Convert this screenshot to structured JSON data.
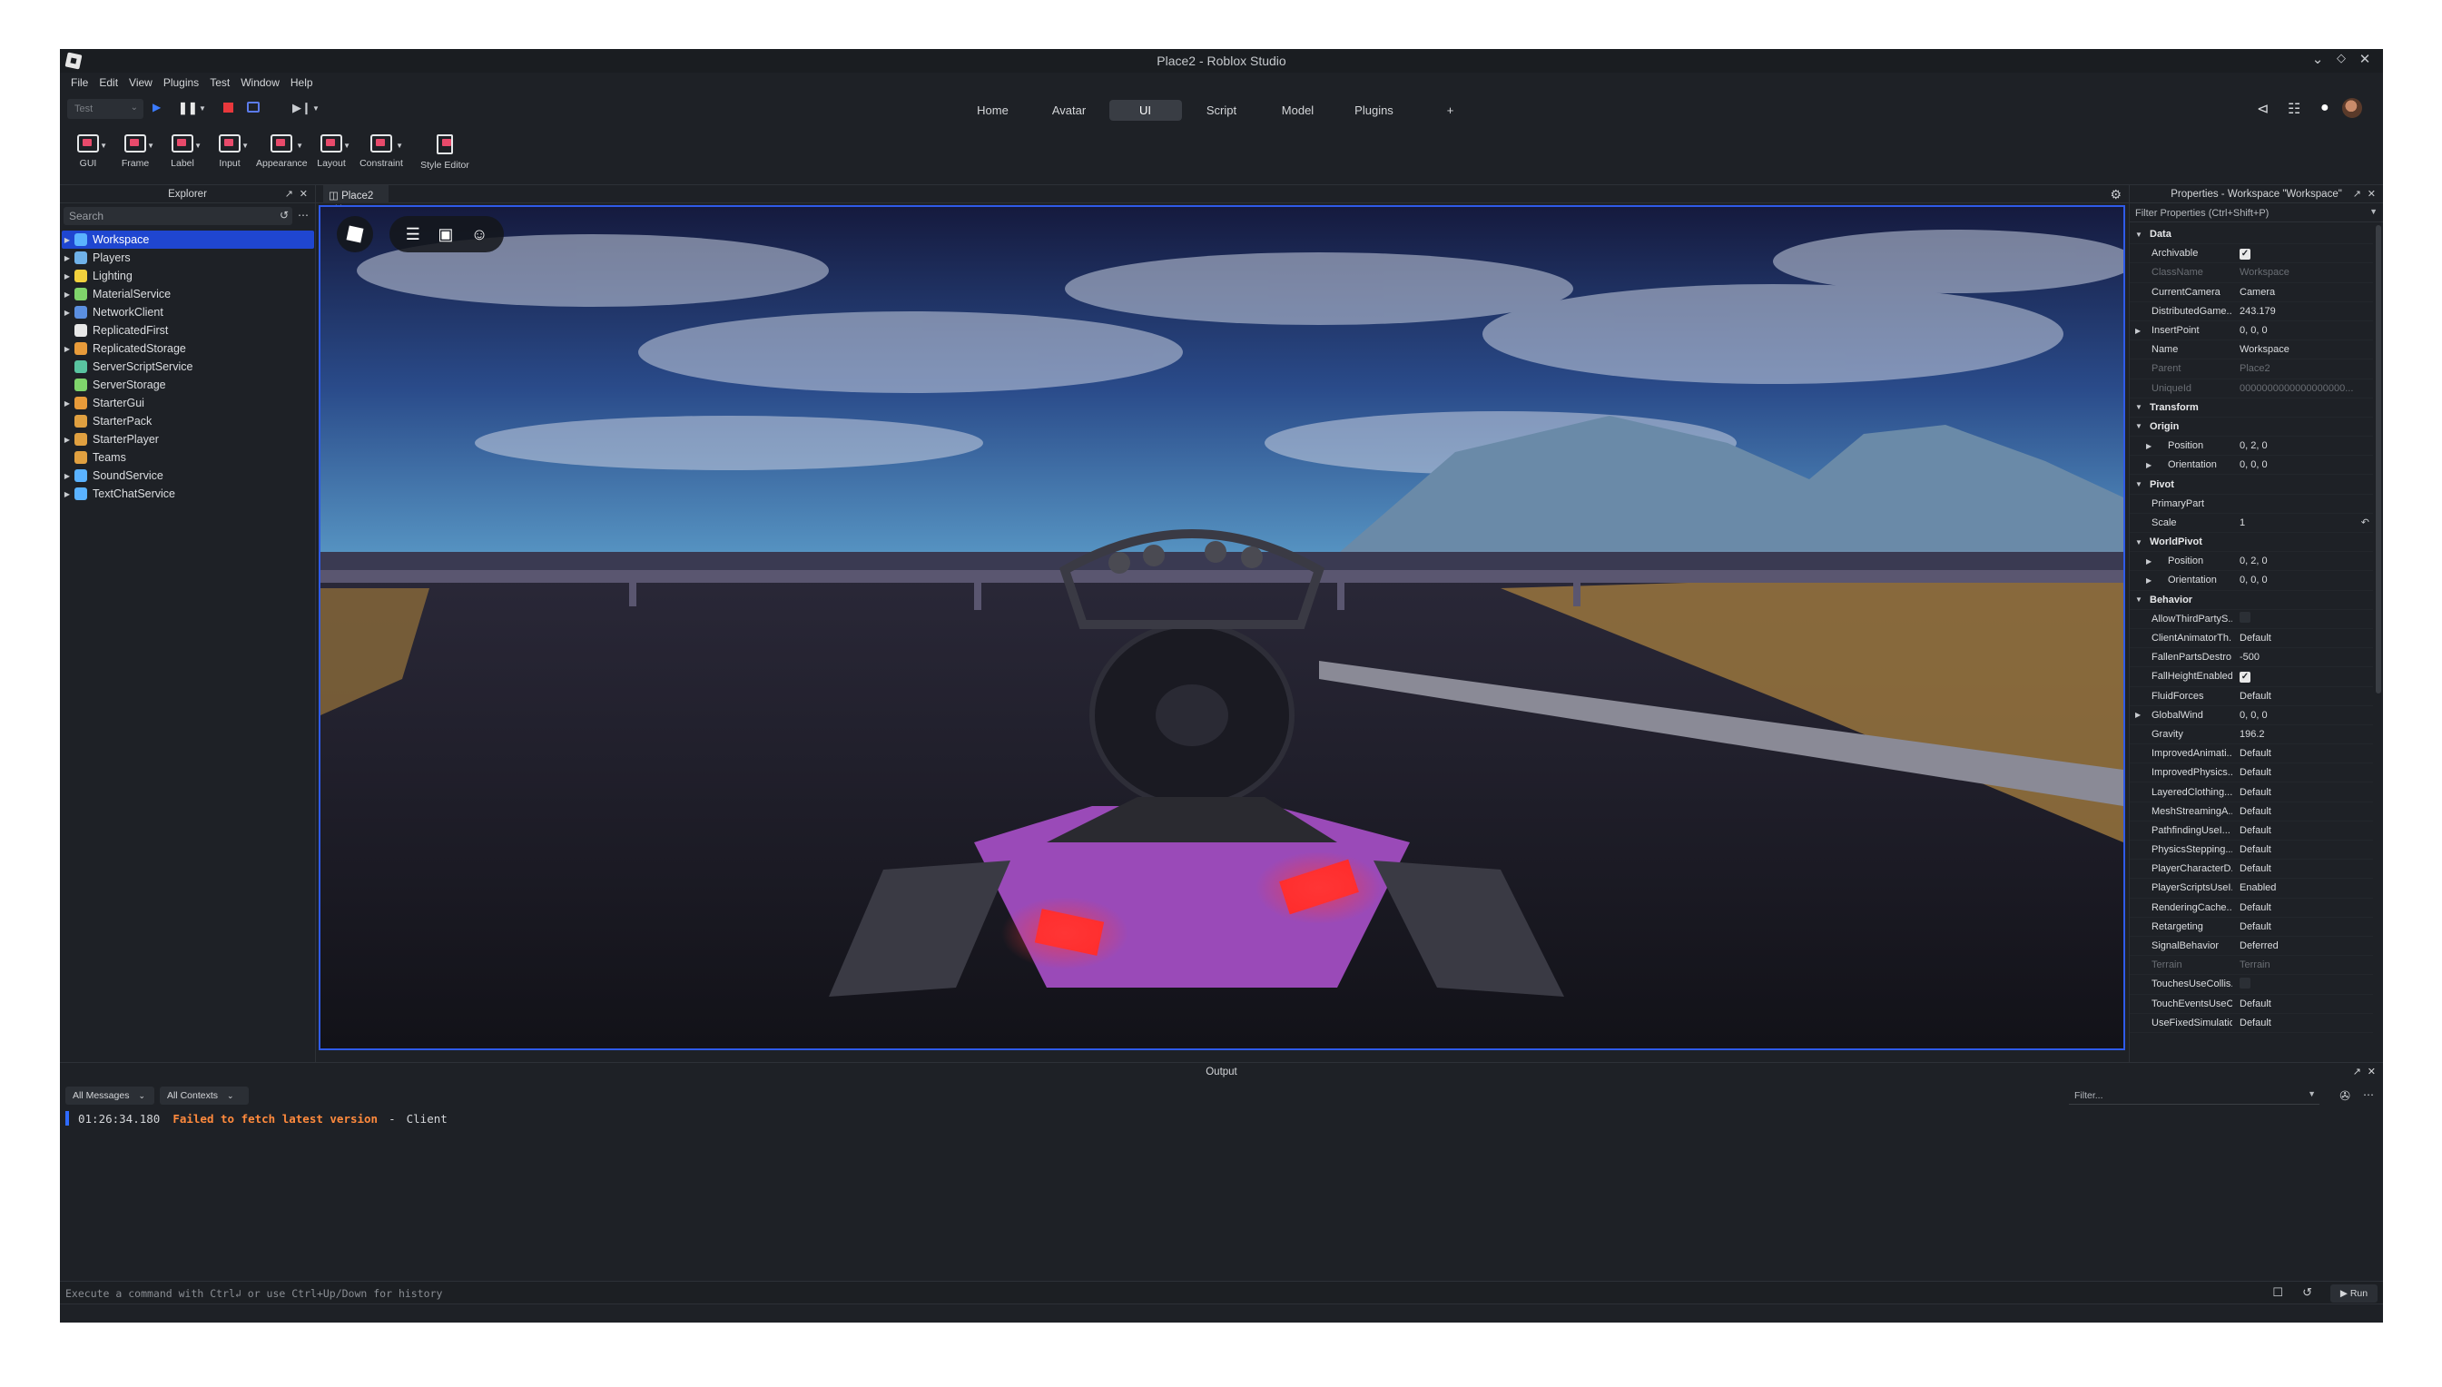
{
  "window": {
    "title": "Place2 - Roblox Studio"
  },
  "menu": [
    "File",
    "Edit",
    "View",
    "Plugins",
    "Test",
    "Window",
    "Help"
  ],
  "toolbar": {
    "test_select": "Test",
    "mode_tabs": [
      {
        "label": "Home",
        "active": false
      },
      {
        "label": "Avatar",
        "active": false
      },
      {
        "label": "UI",
        "active": true
      },
      {
        "label": "Script",
        "active": false
      },
      {
        "label": "Model",
        "active": false
      },
      {
        "label": "Plugins",
        "active": false
      }
    ],
    "add_tab": "+"
  },
  "ribbon": [
    {
      "label": "GUI",
      "name": "gui",
      "dropdown": true
    },
    {
      "label": "Frame",
      "name": "frame",
      "dropdown": true
    },
    {
      "label": "Label",
      "name": "label",
      "dropdown": true
    },
    {
      "label": "Input",
      "name": "input",
      "dropdown": true
    },
    {
      "label": "Appearance",
      "name": "appearance",
      "dropdown": true
    },
    {
      "label": "Layout",
      "name": "layout",
      "dropdown": true
    },
    {
      "label": "Constraint",
      "name": "constraint",
      "dropdown": true
    },
    {
      "label": "Style Editor",
      "name": "style-editor",
      "dropdown": false
    }
  ],
  "explorer": {
    "title": "Explorer",
    "search_placeholder": "Search",
    "items": [
      {
        "label": "Workspace",
        "selected": true,
        "color": "#5ab2ff",
        "expandable": true
      },
      {
        "label": "Players",
        "selected": false,
        "color": "#6fb1e8",
        "expandable": true
      },
      {
        "label": "Lighting",
        "selected": false,
        "color": "#f2d13d",
        "expandable": true
      },
      {
        "label": "MaterialService",
        "selected": false,
        "color": "#7fd46b",
        "expandable": true
      },
      {
        "label": "NetworkClient",
        "selected": false,
        "color": "#5b8fe0",
        "expandable": true
      },
      {
        "label": "ReplicatedFirst",
        "selected": false,
        "color": "#e8e8e8",
        "expandable": false
      },
      {
        "label": "ReplicatedStorage",
        "selected": false,
        "color": "#e89b3a",
        "expandable": true
      },
      {
        "label": "ServerScriptService",
        "selected": false,
        "color": "#59c4a0",
        "expandable": false
      },
      {
        "label": "ServerStorage",
        "selected": false,
        "color": "#7fd46b",
        "expandable": false
      },
      {
        "label": "StarterGui",
        "selected": false,
        "color": "#e89b3a",
        "expandable": true
      },
      {
        "label": "StarterPack",
        "selected": false,
        "color": "#e0a040",
        "expandable": false
      },
      {
        "label": "StarterPlayer",
        "selected": false,
        "color": "#e0a040",
        "expandable": true
      },
      {
        "label": "Teams",
        "selected": false,
        "color": "#e0a040",
        "expandable": false
      },
      {
        "label": "SoundService",
        "selected": false,
        "color": "#5ab2ff",
        "expandable": true
      },
      {
        "label": "TextChatService",
        "selected": false,
        "color": "#5ab2ff",
        "expandable": true
      }
    ]
  },
  "viewport": {
    "tab_label": "Place2"
  },
  "properties": {
    "title": "Properties - Workspace \"Workspace\"",
    "filter_placeholder": "Filter Properties (Ctrl+Shift+P)",
    "rows": [
      {
        "type": "cat",
        "name": "Data"
      },
      {
        "name": "Archivable",
        "value": "",
        "checkbox": true,
        "checked": true
      },
      {
        "name": "ClassName",
        "value": "Workspace",
        "dim": true
      },
      {
        "name": "CurrentCamera",
        "value": "Camera"
      },
      {
        "name": "DistributedGame...",
        "value": "243.179"
      },
      {
        "name": "InsertPoint",
        "value": "0, 0, 0",
        "expandable": true
      },
      {
        "name": "Name",
        "value": "Workspace"
      },
      {
        "name": "Parent",
        "value": "Place2",
        "dim": true
      },
      {
        "name": "UniqueId",
        "value": "0000000000000000000...",
        "dim": true
      },
      {
        "type": "cat",
        "name": "Transform"
      },
      {
        "type": "subcat",
        "name": "Origin"
      },
      {
        "name": "Position",
        "value": "0, 2, 0",
        "sub": true
      },
      {
        "name": "Orientation",
        "value": "0, 0, 0",
        "sub": true
      },
      {
        "type": "subcat",
        "name": "Pivot"
      },
      {
        "name": "PrimaryPart",
        "value": ""
      },
      {
        "name": "Scale",
        "value": "1",
        "reset": true
      },
      {
        "type": "subcat",
        "name": "WorldPivot"
      },
      {
        "name": "Position",
        "value": "0, 2, 0",
        "sub": true
      },
      {
        "name": "Orientation",
        "value": "0, 0, 0",
        "sub": true
      },
      {
        "type": "cat",
        "name": "Behavior"
      },
      {
        "name": "AllowThirdPartyS...",
        "value": "",
        "checkbox": true,
        "checked": false
      },
      {
        "name": "ClientAnimatorTh...",
        "value": "Default"
      },
      {
        "name": "FallenPartsDestro...",
        "value": "-500"
      },
      {
        "name": "FallHeightEnabled",
        "value": "",
        "checkbox": true,
        "checked": true
      },
      {
        "name": "FluidForces",
        "value": "Default"
      },
      {
        "name": "GlobalWind",
        "value": "0, 0, 0",
        "expandable": true
      },
      {
        "name": "Gravity",
        "value": "196.2"
      },
      {
        "name": "ImprovedAnimati...",
        "value": "Default"
      },
      {
        "name": "ImprovedPhysics...",
        "value": "Default"
      },
      {
        "name": "LayeredClothing...",
        "value": "Default"
      },
      {
        "name": "MeshStreamingA...",
        "value": "Default"
      },
      {
        "name": "PathfindingUseI...",
        "value": "Default"
      },
      {
        "name": "PhysicsStepping...",
        "value": "Default"
      },
      {
        "name": "PlayerCharacterD...",
        "value": "Default"
      },
      {
        "name": "PlayerScriptsUseI...",
        "value": "Enabled"
      },
      {
        "name": "RenderingCache...",
        "value": "Default"
      },
      {
        "name": "Retargeting",
        "value": "Default"
      },
      {
        "name": "SignalBehavior",
        "value": "Deferred"
      },
      {
        "name": "Terrain",
        "value": "Terrain",
        "dim": true
      },
      {
        "name": "TouchesUseCollis...",
        "value": "",
        "checkbox": true,
        "checked": false
      },
      {
        "name": "TouchEventsUseC...",
        "value": "Default"
      },
      {
        "name": "UseFixedSimulation",
        "value": "Default"
      }
    ]
  },
  "output": {
    "title": "Output",
    "messages_filter": "All Messages",
    "contexts_filter": "All Contexts",
    "filter_placeholder": "Filter...",
    "log": {
      "timestamp": "01:26:34.180",
      "message": "Failed to fetch latest version",
      "separator": "-",
      "source": "Client"
    },
    "command_placeholder": "Execute a command with Ctrl↲ or use Ctrl+Up/Down for history",
    "run_label": "▶ Run"
  }
}
